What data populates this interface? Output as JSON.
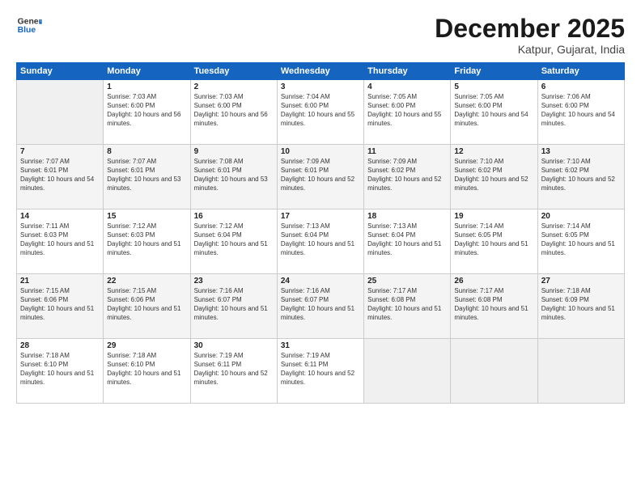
{
  "logo": {
    "line1": "General",
    "line2": "Blue"
  },
  "title": "December 2025",
  "subtitle": "Katpur, Gujarat, India",
  "days_header": [
    "Sunday",
    "Monday",
    "Tuesday",
    "Wednesday",
    "Thursday",
    "Friday",
    "Saturday"
  ],
  "weeks": [
    [
      {
        "num": "",
        "empty": true
      },
      {
        "num": "1",
        "sunrise": "7:03 AM",
        "sunset": "6:00 PM",
        "daylight": "10 hours and 56 minutes."
      },
      {
        "num": "2",
        "sunrise": "7:03 AM",
        "sunset": "6:00 PM",
        "daylight": "10 hours and 56 minutes."
      },
      {
        "num": "3",
        "sunrise": "7:04 AM",
        "sunset": "6:00 PM",
        "daylight": "10 hours and 55 minutes."
      },
      {
        "num": "4",
        "sunrise": "7:05 AM",
        "sunset": "6:00 PM",
        "daylight": "10 hours and 55 minutes."
      },
      {
        "num": "5",
        "sunrise": "7:05 AM",
        "sunset": "6:00 PM",
        "daylight": "10 hours and 54 minutes."
      },
      {
        "num": "6",
        "sunrise": "7:06 AM",
        "sunset": "6:00 PM",
        "daylight": "10 hours and 54 minutes."
      }
    ],
    [
      {
        "num": "7",
        "sunrise": "7:07 AM",
        "sunset": "6:01 PM",
        "daylight": "10 hours and 54 minutes."
      },
      {
        "num": "8",
        "sunrise": "7:07 AM",
        "sunset": "6:01 PM",
        "daylight": "10 hours and 53 minutes."
      },
      {
        "num": "9",
        "sunrise": "7:08 AM",
        "sunset": "6:01 PM",
        "daylight": "10 hours and 53 minutes."
      },
      {
        "num": "10",
        "sunrise": "7:09 AM",
        "sunset": "6:01 PM",
        "daylight": "10 hours and 52 minutes."
      },
      {
        "num": "11",
        "sunrise": "7:09 AM",
        "sunset": "6:02 PM",
        "daylight": "10 hours and 52 minutes."
      },
      {
        "num": "12",
        "sunrise": "7:10 AM",
        "sunset": "6:02 PM",
        "daylight": "10 hours and 52 minutes."
      },
      {
        "num": "13",
        "sunrise": "7:10 AM",
        "sunset": "6:02 PM",
        "daylight": "10 hours and 52 minutes."
      }
    ],
    [
      {
        "num": "14",
        "sunrise": "7:11 AM",
        "sunset": "6:03 PM",
        "daylight": "10 hours and 51 minutes."
      },
      {
        "num": "15",
        "sunrise": "7:12 AM",
        "sunset": "6:03 PM",
        "daylight": "10 hours and 51 minutes."
      },
      {
        "num": "16",
        "sunrise": "7:12 AM",
        "sunset": "6:04 PM",
        "daylight": "10 hours and 51 minutes."
      },
      {
        "num": "17",
        "sunrise": "7:13 AM",
        "sunset": "6:04 PM",
        "daylight": "10 hours and 51 minutes."
      },
      {
        "num": "18",
        "sunrise": "7:13 AM",
        "sunset": "6:04 PM",
        "daylight": "10 hours and 51 minutes."
      },
      {
        "num": "19",
        "sunrise": "7:14 AM",
        "sunset": "6:05 PM",
        "daylight": "10 hours and 51 minutes."
      },
      {
        "num": "20",
        "sunrise": "7:14 AM",
        "sunset": "6:05 PM",
        "daylight": "10 hours and 51 minutes."
      }
    ],
    [
      {
        "num": "21",
        "sunrise": "7:15 AM",
        "sunset": "6:06 PM",
        "daylight": "10 hours and 51 minutes."
      },
      {
        "num": "22",
        "sunrise": "7:15 AM",
        "sunset": "6:06 PM",
        "daylight": "10 hours and 51 minutes."
      },
      {
        "num": "23",
        "sunrise": "7:16 AM",
        "sunset": "6:07 PM",
        "daylight": "10 hours and 51 minutes."
      },
      {
        "num": "24",
        "sunrise": "7:16 AM",
        "sunset": "6:07 PM",
        "daylight": "10 hours and 51 minutes."
      },
      {
        "num": "25",
        "sunrise": "7:17 AM",
        "sunset": "6:08 PM",
        "daylight": "10 hours and 51 minutes."
      },
      {
        "num": "26",
        "sunrise": "7:17 AM",
        "sunset": "6:08 PM",
        "daylight": "10 hours and 51 minutes."
      },
      {
        "num": "27",
        "sunrise": "7:18 AM",
        "sunset": "6:09 PM",
        "daylight": "10 hours and 51 minutes."
      }
    ],
    [
      {
        "num": "28",
        "sunrise": "7:18 AM",
        "sunset": "6:10 PM",
        "daylight": "10 hours and 51 minutes."
      },
      {
        "num": "29",
        "sunrise": "7:18 AM",
        "sunset": "6:10 PM",
        "daylight": "10 hours and 51 minutes."
      },
      {
        "num": "30",
        "sunrise": "7:19 AM",
        "sunset": "6:11 PM",
        "daylight": "10 hours and 52 minutes."
      },
      {
        "num": "31",
        "sunrise": "7:19 AM",
        "sunset": "6:11 PM",
        "daylight": "10 hours and 52 minutes."
      },
      {
        "num": "",
        "empty": true
      },
      {
        "num": "",
        "empty": true
      },
      {
        "num": "",
        "empty": true
      }
    ]
  ]
}
